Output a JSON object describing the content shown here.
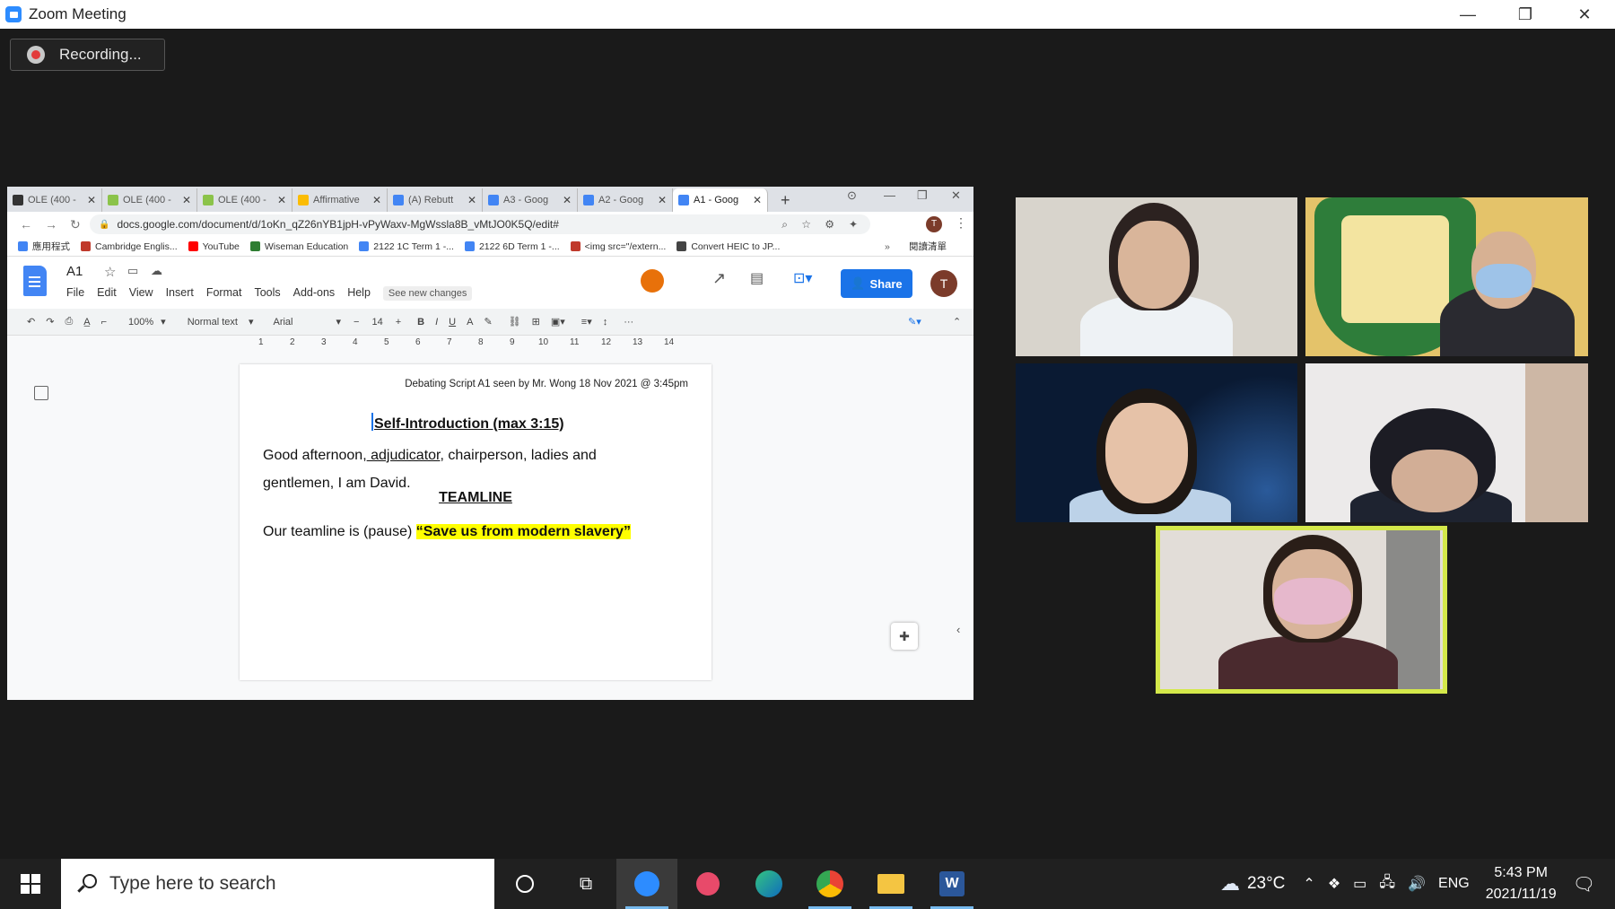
{
  "window": {
    "title": "Zoom Meeting"
  },
  "recording": {
    "label": "Recording..."
  },
  "browser": {
    "tabs": [
      {
        "label": "OLE (400 -",
        "color": "#333333"
      },
      {
        "label": "OLE (400 -",
        "color": "#8bc34a"
      },
      {
        "label": "OLE (400 -",
        "color": "#8bc34a"
      },
      {
        "label": "Affirmative",
        "color": "#fbbc04"
      },
      {
        "label": "(A) Rebutt",
        "color": "#4285f4"
      },
      {
        "label": "A3 - Goog",
        "color": "#4285f4"
      },
      {
        "label": "A2 - Goog",
        "color": "#4285f4"
      },
      {
        "label": "A1 - Goog",
        "color": "#4285f4"
      }
    ],
    "url": "docs.google.com/document/d/1oKn_qZ26nYB1jpH-vPyWaxv-MgWssla8B_vMtJO0K5Q/edit#",
    "bookmarks": [
      {
        "label": "應用程式",
        "color": "#4285f4"
      },
      {
        "label": "Cambridge Englis...",
        "color": "#c0392b"
      },
      {
        "label": "YouTube",
        "color": "#ff0000"
      },
      {
        "label": "Wiseman Education",
        "color": "#2e7d32"
      },
      {
        "label": "2122 1C Term 1 -...",
        "color": "#4285f4"
      },
      {
        "label": "2122 6D Term 1 -...",
        "color": "#4285f4"
      },
      {
        "label": "<img src=\"/extern...",
        "color": "#c0392b"
      },
      {
        "label": "Convert HEIC to JP...",
        "color": "#444444"
      }
    ],
    "reading_list": "閱讀清單"
  },
  "docs": {
    "title": "A1",
    "menu": [
      "File",
      "Edit",
      "View",
      "Insert",
      "Format",
      "Tools",
      "Add-ons",
      "Help"
    ],
    "see_new_changes": "See new changes",
    "share_label": "Share",
    "avatar_initial": "T",
    "toolbar": {
      "zoom": "100%",
      "style": "Normal text",
      "font": "Arial",
      "size": "14"
    },
    "ruler": [
      "1",
      "2",
      "3",
      "4",
      "5",
      "6",
      "7",
      "8",
      "9",
      "10",
      "11",
      "12",
      "13",
      "14"
    ],
    "content": {
      "header": "Debating Script A1  seen by Mr. Wong 18 Nov 2021 @ 3:45pm",
      "heading1": "Self-Introduction (max 3:15)",
      "p1_start": "Good afternoon,",
      "p1_link": " adjudicator",
      "p1_end": ", chairperson, ladies and gentlemen, I am David.",
      "heading2": "TEAMLINE",
      "p2_start": "Our teamline is (pause) ",
      "p2_highlight": "“Save us from modern slavery”"
    }
  },
  "taskbar": {
    "search_placeholder": "Type here to search",
    "weather": "23°C",
    "language": "ENG",
    "time": "5:43 PM",
    "date": "2021/11/19"
  }
}
